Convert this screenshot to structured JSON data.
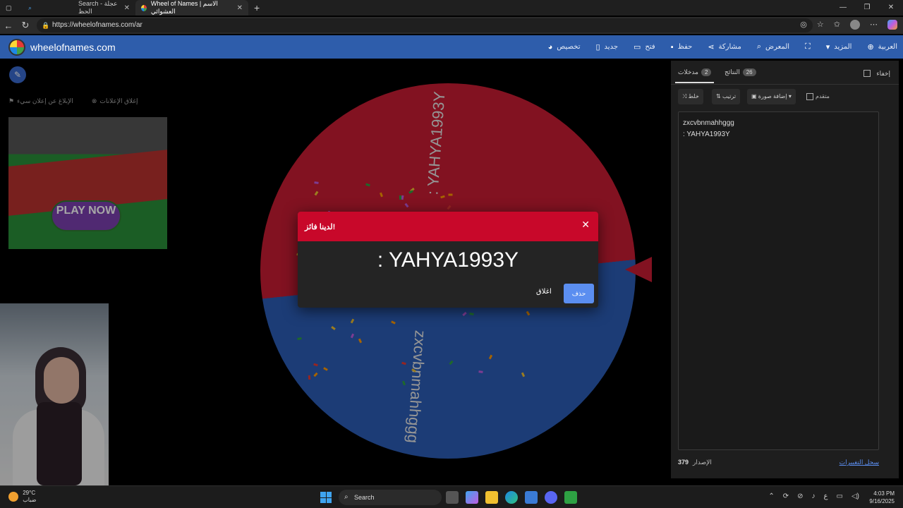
{
  "browser": {
    "tabs": [
      {
        "label": "Search - عجلة الحظ",
        "active": false
      },
      {
        "label": "Wheel of Names | الاسم العشوائي",
        "active": true
      }
    ],
    "url": "https://wheelofnames.com/ar"
  },
  "app": {
    "brand": "wheelofnames.com",
    "menu": [
      {
        "label": "تخصيص",
        "icon": "palette-icon"
      },
      {
        "label": "جديد",
        "icon": "file-icon"
      },
      {
        "label": "فتح",
        "icon": "folder-icon"
      },
      {
        "label": "حفظ",
        "icon": "save-icon"
      },
      {
        "label": "مشاركة",
        "icon": "share-icon"
      },
      {
        "label": "المعرض",
        "icon": "search-icon"
      },
      {
        "label": "",
        "icon": "fullscreen-icon"
      },
      {
        "label": "المزيد",
        "icon": "chevron-down-icon"
      },
      {
        "label": "العربية",
        "icon": "globe-icon"
      }
    ]
  },
  "ads": {
    "close_ads": "إغلاق الإعلانات",
    "report_ad": "الإبلاغ عن إعلان سيء",
    "play_now": "PLAY NOW"
  },
  "wheel": {
    "segments": [
      {
        "label": ": YAHYA1993Y",
        "color": "#c81d33"
      },
      {
        "label": "zxcvbnmahhggg",
        "color": "#2b5cb6"
      }
    ]
  },
  "winner_dialog": {
    "title": "لدينا فائز!",
    "winner": ": YAHYA1993Y",
    "close_label": "اغلاق",
    "remove_label": "حذف"
  },
  "panel": {
    "tab_entries": "مدخلات",
    "entries_count": "2",
    "tab_results": "النتائج",
    "results_count": "26",
    "hide_label": "إخفاء",
    "shuffle_label": "خلط",
    "sort_label": "ترتيب",
    "add_image_label": "إضافة صورة",
    "advanced_label": "متقدم",
    "entries": [
      "zxcvbnmahhggg",
      ": YAHYA1993Y"
    ],
    "version_label": "الإصدار",
    "version": "379",
    "changelog_label": "سجل التغييرات"
  },
  "taskbar": {
    "temp": "29°C",
    "weather": "ضباب",
    "search": "Search",
    "time": "4:03 PM",
    "date": "9/16/2025"
  }
}
